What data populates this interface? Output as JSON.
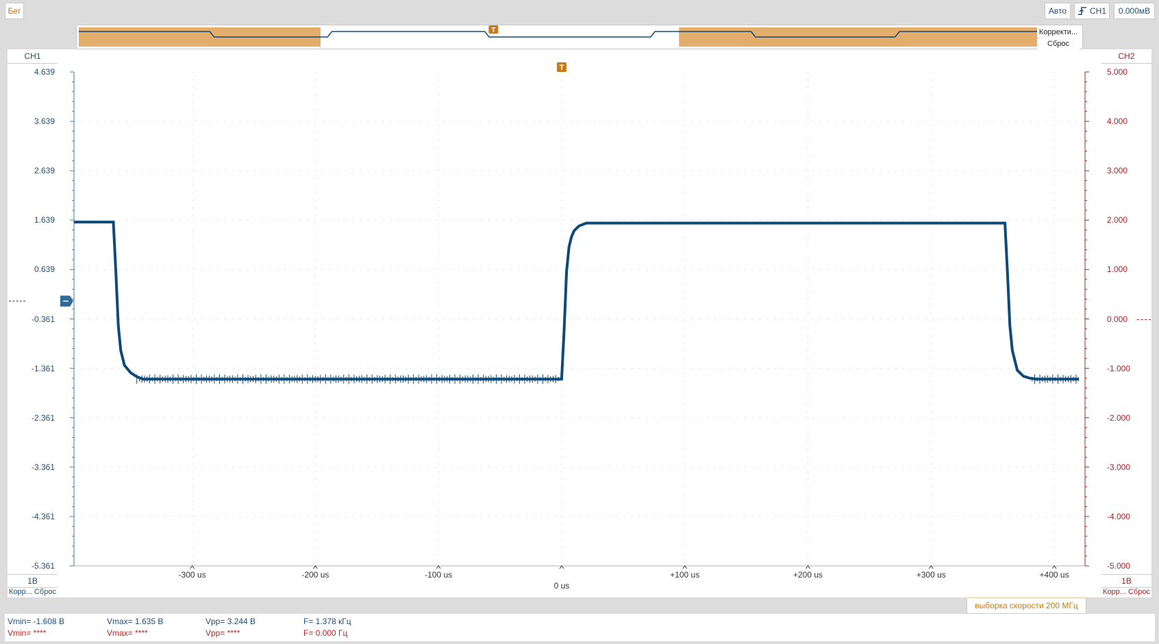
{
  "toolbar": {
    "run_label": "Бег",
    "trigger_mode": "Авто",
    "trigger_source": "CH1",
    "trigger_level": "0.000мВ"
  },
  "overview": {
    "zoom_button": "Корректи...",
    "reset_button": "Сброс"
  },
  "ch1": {
    "label": "CH1",
    "scale": "1В",
    "auto_label": "Корр...",
    "reset_label": "Сброс",
    "ticks": [
      "4.639",
      "3.639",
      "2.639",
      "1.639",
      "0.639",
      "-0.361",
      "-1.361",
      "-2.361",
      "-3.361",
      "-4.361",
      "-5.361"
    ]
  },
  "ch2": {
    "label": "CH2",
    "scale": "1В",
    "auto_label": "Корр...",
    "reset_label": "Сброс",
    "ticks": [
      "5.000",
      "4.000",
      "3.000",
      "2.000",
      "1.000",
      "0.000",
      "-1.000",
      "-2.000",
      "-3.000",
      "-4.000",
      "-5.000"
    ]
  },
  "time_axis": {
    "ticks": [
      "-300 us",
      "-200 us",
      "-100 us",
      "0 us",
      "+100 us",
      "+200 us",
      "+300 us",
      "+400 us"
    ]
  },
  "sample_rate": "выборка скорости 200 МГц",
  "measurements": {
    "ch1": {
      "vmin": "Vmin= -1.608 В",
      "vmax": "Vmax= 1.635 В",
      "vpp": "Vpp= 3.244 В",
      "freq": "F= 1.378 кГц"
    },
    "ch2": {
      "vmin": "Vmin= ****",
      "vmax": "Vmax= ****",
      "vpp": "Vpp= ****",
      "freq": "F= 0.000 Гц"
    }
  },
  "colors": {
    "trace": "#0e4a78",
    "ch2": "#b02020",
    "accent": "#c87a14",
    "overview_fill": "#e3ad6c"
  },
  "chart_data": {
    "type": "line",
    "x_unit": "us",
    "xlim": [
      -396,
      425
    ],
    "ylim": [
      -5.361,
      4.639
    ],
    "grid": true,
    "series": [
      {
        "x": [
          -396,
          -364,
          -362,
          -360,
          -358,
          -355,
          -350,
          -345,
          -340,
          0,
          2,
          4,
          6,
          8,
          10,
          14,
          20,
          360,
          362,
          364,
          366,
          370,
          375,
          380,
          385,
          420
        ],
        "y": [
          1.6,
          1.6,
          0.6,
          -0.5,
          -1.0,
          -1.3,
          -1.45,
          -1.53,
          -1.58,
          -1.58,
          -0.6,
          0.6,
          1.1,
          1.3,
          1.42,
          1.52,
          1.58,
          1.58,
          0.6,
          -0.5,
          -1.0,
          -1.4,
          -1.52,
          -1.56,
          -1.58,
          -1.58
        ]
      }
    ]
  }
}
